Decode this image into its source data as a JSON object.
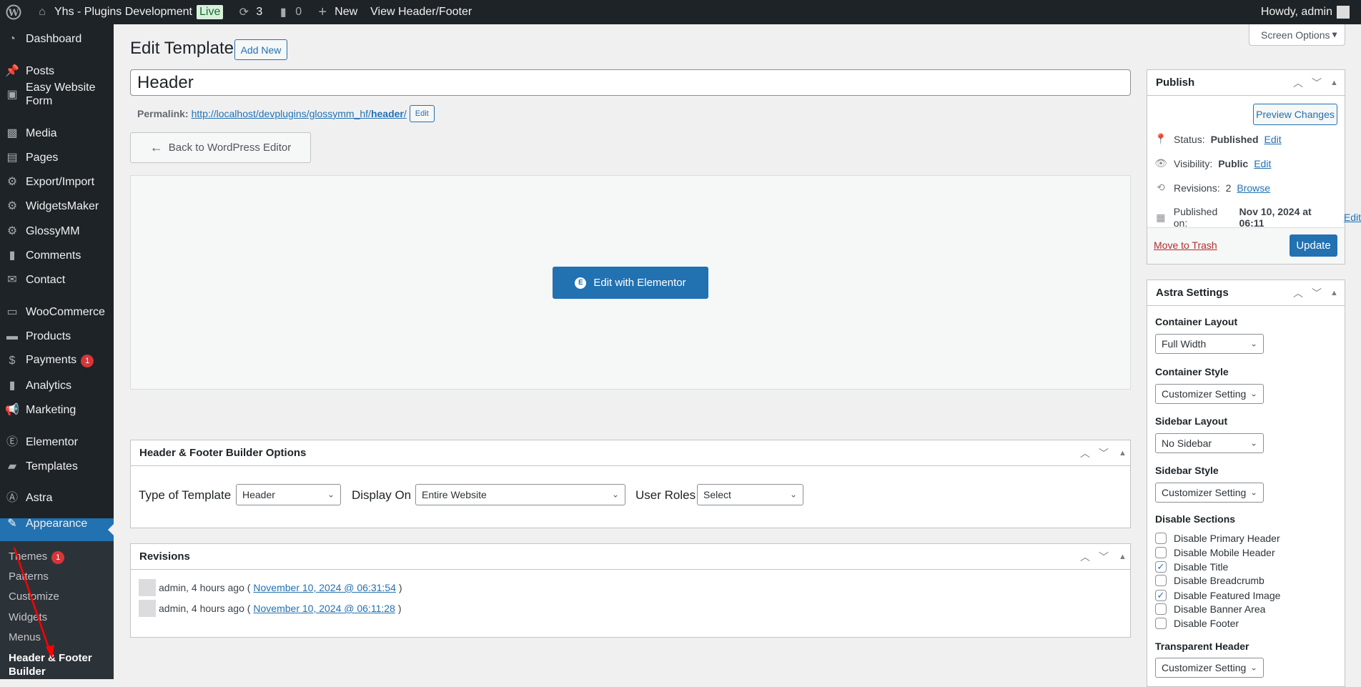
{
  "adminbar": {
    "site": "Yhs - Plugins Development",
    "live": "Live",
    "updates": "3",
    "comments": "0",
    "new": "New",
    "view": "View Header/Footer",
    "howdy": "Howdy, admin"
  },
  "sidebar": {
    "items": [
      {
        "label": "Dashboard",
        "icon": "dashboard-icon"
      },
      {
        "label": "Posts",
        "icon": "pin-icon"
      },
      {
        "label": "Easy Website Form",
        "icon": "form-icon"
      },
      {
        "label": "Media",
        "icon": "media-icon"
      },
      {
        "label": "Pages",
        "icon": "pages-icon"
      },
      {
        "label": "Export/Import",
        "icon": "gear-icon"
      },
      {
        "label": "WidgetsMaker",
        "icon": "gear-icon"
      },
      {
        "label": "GlossyMM",
        "icon": "gear-icon"
      },
      {
        "label": "Comments",
        "icon": "comment-icon"
      },
      {
        "label": "Contact",
        "icon": "mail-icon"
      },
      {
        "label": "WooCommerce",
        "icon": "woo-icon"
      },
      {
        "label": "Products",
        "icon": "archive-icon"
      },
      {
        "label": "Payments",
        "icon": "dollar-icon",
        "badge": "1"
      },
      {
        "label": "Analytics",
        "icon": "chart-icon"
      },
      {
        "label": "Marketing",
        "icon": "megaphone-icon"
      },
      {
        "label": "Elementor",
        "icon": "elementor-icon"
      },
      {
        "label": "Templates",
        "icon": "folder-icon"
      },
      {
        "label": "Astra",
        "icon": "astra-icon"
      },
      {
        "label": "Appearance",
        "icon": "brush-icon"
      }
    ],
    "submenu": [
      {
        "label": "Themes",
        "badge": "1"
      },
      {
        "label": "Patterns"
      },
      {
        "label": "Customize"
      },
      {
        "label": "Widgets"
      },
      {
        "label": "Menus"
      },
      {
        "label": "Header & Footer Builder"
      }
    ]
  },
  "screen_options": "Screen Options",
  "page": {
    "title": "Edit Template",
    "add_new": "Add New",
    "post_title": "Header",
    "permalink_label": "Permalink:",
    "permalink_base": "http://localhost/devplugins/glossymm_hf/",
    "permalink_slug": "header",
    "permalink_end": "/",
    "permalink_edit": "Edit",
    "back_button": "Back to WordPress Editor",
    "elementor_button": "Edit with Elementor"
  },
  "hfb": {
    "title": "Header & Footer Builder Options",
    "type_label": "Type of Template",
    "type_value": "Header",
    "display_label": "Display On",
    "display_value": "Entire Website",
    "roles_label": "User Roles",
    "roles_value": "Select"
  },
  "revisions": {
    "title": "Revisions",
    "items": [
      {
        "text": "admin, 4 hours ago (",
        "link": "November 10, 2024 @ 06:31:54",
        "end": ")"
      },
      {
        "text": "admin, 4 hours ago (",
        "link": "November 10, 2024 @ 06:11:28",
        "end": ")"
      }
    ]
  },
  "publish": {
    "title": "Publish",
    "preview": "Preview Changes",
    "status_label": "Status:",
    "status": "Published",
    "visibility_label": "Visibility:",
    "visibility": "Public",
    "revisions_label": "Revisions:",
    "revisions": "2",
    "browse": "Browse",
    "published_label": "Published on:",
    "published": "Nov 10, 2024 at 06:11",
    "edit": "Edit",
    "trash": "Move to Trash",
    "update": "Update"
  },
  "astra": {
    "title": "Astra Settings",
    "container_layout_label": "Container Layout",
    "container_layout": "Full Width",
    "container_style_label": "Container Style",
    "container_style": "Customizer Setting",
    "sidebar_layout_label": "Sidebar Layout",
    "sidebar_layout": "No Sidebar",
    "sidebar_style_label": "Sidebar Style",
    "sidebar_style": "Customizer Setting",
    "disable_label": "Disable Sections",
    "checks": [
      {
        "label": "Disable Primary Header",
        "checked": false
      },
      {
        "label": "Disable Mobile Header",
        "checked": false
      },
      {
        "label": "Disable Title",
        "checked": true
      },
      {
        "label": "Disable Breadcrumb",
        "checked": false
      },
      {
        "label": "Disable Featured Image",
        "checked": true
      },
      {
        "label": "Disable Banner Area",
        "checked": false
      },
      {
        "label": "Disable Footer",
        "checked": false
      }
    ],
    "transparent_label": "Transparent Header",
    "transparent": "Customizer Setting"
  },
  "colors": {
    "accent": "#2271b1",
    "sidebar": "#1d2327",
    "annotation": "#ff0000"
  }
}
